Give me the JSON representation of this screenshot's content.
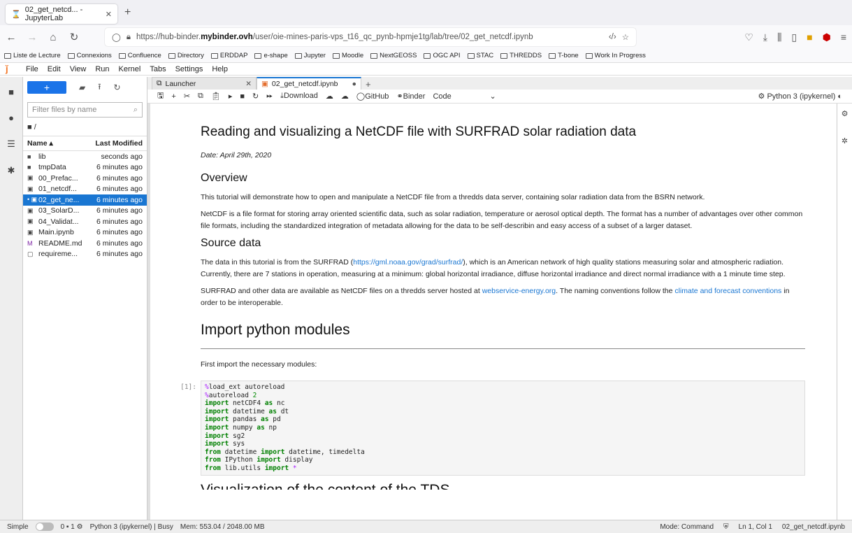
{
  "browser": {
    "tab_title": "02_get_netcd... - JupyterLab",
    "url_prefix": "https://hub-binder.",
    "url_host": "mybinder.ovh",
    "url_path": "/user/oie-mines-paris-vps_t16_qc_pynb-hpmje1tg/lab/tree/02_get_netcdf.ipynb"
  },
  "bookmarks": [
    "Liste de Lecture",
    "Connexions",
    "Confluence",
    "Directory",
    "ERDDAP",
    "e-shape",
    "Jupyter",
    "Moodle",
    "NextGEOSS",
    "OGC API",
    "STAC",
    "THREDDS",
    "T-bone",
    "Work In Progress"
  ],
  "menu": [
    "File",
    "Edit",
    "View",
    "Run",
    "Kernel",
    "Tabs",
    "Settings",
    "Help"
  ],
  "filebrowser": {
    "filter_placeholder": "Filter files by name",
    "crumb": "/",
    "col_name": "Name",
    "col_modified": "Last Modified",
    "files": [
      {
        "name": "lib",
        "modified": "seconds ago",
        "icon": "folder-icon"
      },
      {
        "name": "tmpData",
        "modified": "6 minutes ago",
        "icon": "folder-icon"
      },
      {
        "name": "00_Prefac...",
        "modified": "6 minutes ago",
        "icon": "notebook-icon"
      },
      {
        "name": "01_netcdf...",
        "modified": "6 minutes ago",
        "icon": "notebook-icon"
      },
      {
        "name": "02_get_ne...",
        "modified": "6 minutes ago",
        "icon": "notebook-icon"
      },
      {
        "name": "03_SolarD...",
        "modified": "6 minutes ago",
        "icon": "notebook-icon"
      },
      {
        "name": "04_Validat...",
        "modified": "6 minutes ago",
        "icon": "notebook-icon"
      },
      {
        "name": "Main.ipynb",
        "modified": "6 minutes ago",
        "icon": "notebook-icon"
      },
      {
        "name": "README.md",
        "modified": "6 minutes ago",
        "icon": "markdown-icon"
      },
      {
        "name": "requireme...",
        "modified": "6 minutes ago",
        "icon": "file-icon"
      }
    ]
  },
  "doctabs": {
    "launcher": "Launcher",
    "notebook": "02_get_netcdf.ipynb"
  },
  "toolbar": {
    "download": "Download",
    "github": "GitHub",
    "binder": "Binder",
    "celltype": "Code",
    "kernel": "Python 3 (ipykernel)"
  },
  "notebook": {
    "title": "Reading and visualizing a NetCDF file with SURFRAD solar radiation data",
    "date": "Date: April 29th, 2020",
    "h_overview": "Overview",
    "p1": "This tutorial will demonstrate how to open and manipulate a NetCDF file from a thredds data server, containing solar radiation data from the BSRN network.",
    "p2": "NetCDF is a file format for storing array oriented scientific data, such as solar radiation, temperature or aerosol optical depth. The format has a number of advantages over other common file formats, including the standardized integration of metadata allowing for the data to be self-describin and easy access of a subset of a larger dataset.",
    "h_source": "Source data",
    "p3a": "The data in this tutorial is from the SURFRAD (",
    "p3link": "https://gml.noaa.gov/grad/surfrad/",
    "p3b": "), which is an American network of high quality stations measuring solar and atmospheric radiation. Currently, there are 7 stations in operation, measuring at a minimum: global horizontal irradiance, diffuse horizontal irradiance and direct normal irradiance with a 1 minute time step.",
    "p4a": "SURFRAD and other data are available as NetCDF files on a thredds server hosted at ",
    "p4link1": "webservice-energy.org",
    "p4b": ". The naming conventions follow the ",
    "p4link2": "climate and forecast conventions",
    "p4c": " in order to be interoperable.",
    "h_import": "Import python modules",
    "p5": "First import the necessary modules:",
    "prompt": "[1]:",
    "h_next": "Visualization of the content of the TDS"
  },
  "status": {
    "mode": "Simple",
    "counts": "0",
    "terminals": "1",
    "kernel": "Python 3 (ipykernel) | Busy",
    "mem": "Mem: 553.04 / 2048.00 MB",
    "cmdmode": "Mode: Command",
    "pos": "Ln 1, Col 1",
    "file": "02_get_netcdf.ipynb"
  }
}
